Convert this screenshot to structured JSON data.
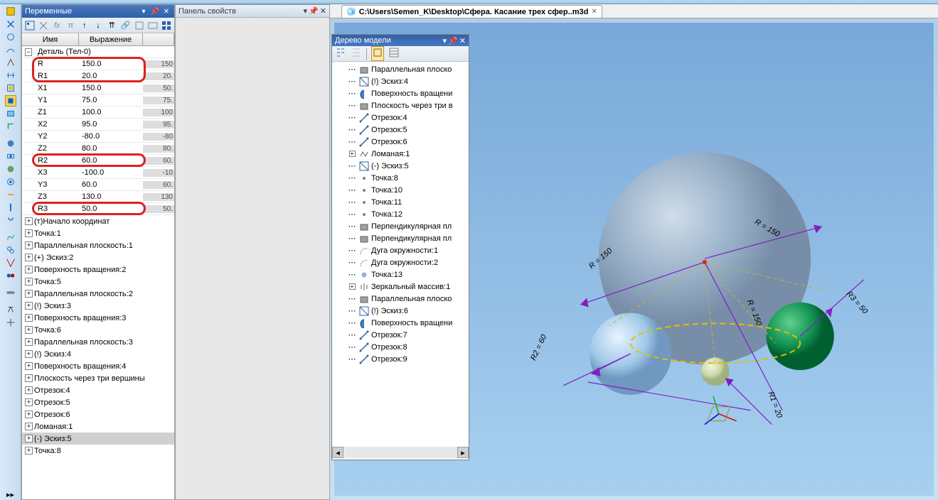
{
  "panels": {
    "variables": {
      "title": "Переменные"
    },
    "properties": {
      "title": "Панель свойств"
    },
    "model_tree": {
      "title": "Дерево модели"
    }
  },
  "doc_tab": {
    "icon": "cube-icon",
    "path": "C:\\Users\\Semen_K\\Desktop\\Сфера. Касание трех сфер..m3d"
  },
  "var_headers": {
    "name": "Имя",
    "expr": "Выражение"
  },
  "var_root": "Деталь (Тел-0)",
  "vars": [
    {
      "name": "R",
      "expr": "150.0",
      "val": "150",
      "hl": true
    },
    {
      "name": "R1",
      "expr": "20.0",
      "val": "20.",
      "hl": true
    },
    {
      "name": "X1",
      "expr": "150.0",
      "val": "50."
    },
    {
      "name": "Y1",
      "expr": "75.0",
      "val": "75."
    },
    {
      "name": "Z1",
      "expr": "100.0",
      "val": "100"
    },
    {
      "name": "X2",
      "expr": "95.0",
      "val": "95."
    },
    {
      "name": "Y2",
      "expr": "-80.0",
      "val": "-80"
    },
    {
      "name": "Z2",
      "expr": "80.0",
      "val": "80."
    },
    {
      "name": "R2",
      "expr": "60.0",
      "val": "60.",
      "hl": true
    },
    {
      "name": "X3",
      "expr": "-100.0",
      "val": "-10"
    },
    {
      "name": "Y3",
      "expr": "60.0",
      "val": "60."
    },
    {
      "name": "Z3",
      "expr": "130.0",
      "val": "130"
    },
    {
      "name": "R3",
      "expr": "50.0",
      "val": "50.",
      "hl": true
    }
  ],
  "var_tree": [
    "(т)Начало координат",
    "Точка:1",
    "Параллельная плоскость:1",
    "(+) Эскиз:2",
    "Поверхность вращения:2",
    "Точка:5",
    "Параллельная плоскость:2",
    "(!) Эскиз:3",
    "Поверхность вращения:3",
    "Точка:6",
    "Параллельная плоскость:3",
    "(!) Эскиз:4",
    "Поверхность вращения:4",
    "Плоскость через три вершины",
    "Отрезок:4",
    "Отрезок:5",
    "Отрезок:6",
    "Ломаная:1",
    "(-) Эскиз:5",
    "Точка:8"
  ],
  "var_tree_selected": 18,
  "model_tree": [
    {
      "ico": "plane",
      "label": "Параллельная плоско"
    },
    {
      "ico": "sketch",
      "label": "(!) Эскиз:4"
    },
    {
      "ico": "revolve",
      "label": "Поверхность вращени"
    },
    {
      "ico": "plane",
      "label": "Плоскость через три в"
    },
    {
      "ico": "line",
      "label": "Отрезок:4"
    },
    {
      "ico": "line",
      "label": "Отрезок:5"
    },
    {
      "ico": "line",
      "label": "Отрезок:6"
    },
    {
      "ico": "polyline",
      "label": "Ломаная:1",
      "exp": "+"
    },
    {
      "ico": "sketch",
      "label": "(-) Эскиз:5"
    },
    {
      "ico": "point",
      "label": "Точка:8"
    },
    {
      "ico": "point",
      "label": "Точка:10"
    },
    {
      "ico": "point",
      "label": "Точка:11"
    },
    {
      "ico": "point",
      "label": "Точка:12"
    },
    {
      "ico": "plane",
      "label": "Перпендикулярная пл"
    },
    {
      "ico": "plane",
      "label": "Перпендикулярная пл"
    },
    {
      "ico": "arc",
      "label": "Дуга окружности:1"
    },
    {
      "ico": "arc",
      "label": "Дуга окружности:2"
    },
    {
      "ico": "point2",
      "label": "Точка:13"
    },
    {
      "ico": "mirror",
      "label": "Зеркальный массив:1",
      "exp": "+"
    },
    {
      "ico": "plane",
      "label": "Параллельная плоско"
    },
    {
      "ico": "sketch",
      "label": "(!) Эскиз:6"
    },
    {
      "ico": "revolve",
      "label": "Поверхность вращени"
    },
    {
      "ico": "line",
      "label": "Отрезок:7"
    },
    {
      "ico": "line",
      "label": "Отрезок:8"
    },
    {
      "ico": "line",
      "label": "Отрезок:9"
    }
  ],
  "labels_3d": {
    "r": "R = 150",
    "r_top": "R = 150",
    "r1": "R1 = 20",
    "r2": "R2 = 60",
    "r3": "R3 = 50",
    "r_mid": "R = 150"
  }
}
